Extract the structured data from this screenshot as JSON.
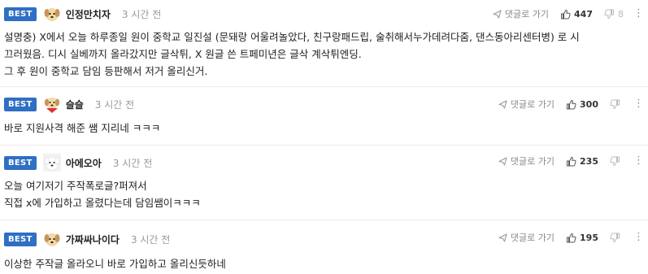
{
  "labels": {
    "best": "BEST",
    "reply": "댓글로 가기"
  },
  "colors": {
    "badge": "#2f6fc4",
    "text": "#222222",
    "meta": "#999999"
  },
  "comments": [
    {
      "nick": "인정만치자",
      "time": "3 시간 전",
      "avatar": "dog-icon",
      "up": "447",
      "down": "8",
      "lines": [
        "설명충) X에서 오늘 하루종일 원이 중학교 일진설 (문돼랑 어울려놀았다, 친구랑패드립, 술취해서누가데려다줌, 댄스동아리센터병) 로 시",
        "끄러웠음. 디시 실베까지 올라갔지만 글삭튀, X 원글 쓴 트페미년은 글삭 계삭튀엔딩.",
        "그 후 원이 중학교 담임 등판해서 저거 올리신거."
      ]
    },
    {
      "nick": "슬슬",
      "time": "3 시간 전",
      "avatar": "dog-red-icon",
      "up": "300",
      "down": "",
      "lines": [
        "바로 지원사격 해준 쌤 지리네 ㅋㅋㅋ"
      ]
    },
    {
      "nick": "아에오아",
      "time": "3 시간 전",
      "avatar": "white-dog-icon",
      "up": "235",
      "down": "",
      "lines": [
        "오늘 여기저기 주작폭로글?퍼져서",
        "직접 x에 가입하고 올렸다는데 담임쌤이ㅋㅋㅋ"
      ]
    },
    {
      "nick": "가짜싸나이다",
      "time": "3 시간 전",
      "avatar": "dog-icon",
      "up": "195",
      "down": "",
      "lines": [
        "이상한 주작글 올라오니 바로 가입하고 올리신듯하네"
      ]
    }
  ]
}
